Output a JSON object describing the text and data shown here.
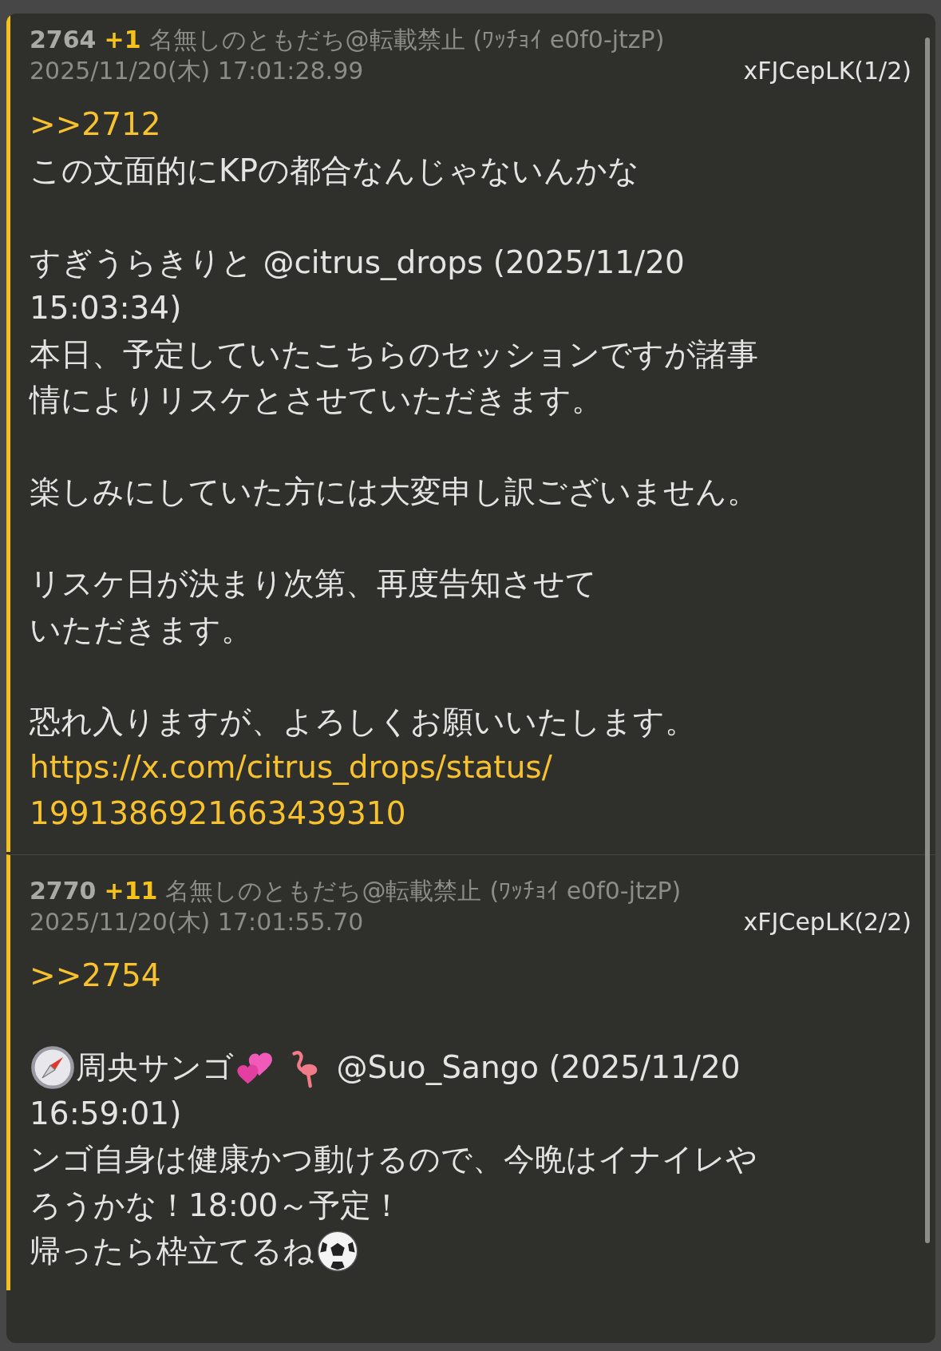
{
  "posts": [
    {
      "number": "2764",
      "votes": "+1",
      "name": "名無しのともだち@転載禁止",
      "trip": "(ﾜｯﾁｮｲ e0f0-jtzP)",
      "date": "2025/11/20(木) 17:01:28.99",
      "id": "xFJCepLK(1/2)",
      "lines": [
        {
          "kind": "quote",
          "text": ">>2712"
        },
        {
          "kind": "text",
          "text": "この文面的にKPの都合なんじゃないんかな"
        },
        {
          "kind": "blank"
        },
        {
          "kind": "text",
          "text": "すぎうらきりと @citrus_drops (2025/11/20"
        },
        {
          "kind": "text",
          "text": "15:03:34)"
        },
        {
          "kind": "text",
          "text": "本日、予定していたこちらのセッションですが諸事"
        },
        {
          "kind": "text",
          "text": "情によりリスケとさせていただきます。"
        },
        {
          "kind": "blank"
        },
        {
          "kind": "text",
          "text": "楽しみにしていた方には大変申し訳ございません。"
        },
        {
          "kind": "blank"
        },
        {
          "kind": "text",
          "text": "リスケ日が決まり次第、再度告知させて"
        },
        {
          "kind": "text",
          "text": "いただきます。"
        },
        {
          "kind": "blank"
        },
        {
          "kind": "text",
          "text": "恐れ入りますが、よろしくお願いいたします。"
        },
        {
          "kind": "link",
          "text": "https://x.com/citrus_drops/status/"
        },
        {
          "kind": "link",
          "text": "1991386921663439310"
        }
      ]
    },
    {
      "number": "2770",
      "votes": "+11",
      "name": "名無しのともだち@転載禁止",
      "trip": "(ﾜｯﾁｮｲ e0f0-jtzP)",
      "date": "2025/11/20(木) 17:01:55.70",
      "id": "xFJCepLK(2/2)",
      "lines": [
        {
          "kind": "quote",
          "text": ">>2754"
        },
        {
          "kind": "blank"
        },
        {
          "kind": "mixed",
          "parts": [
            {
              "kind": "compass"
            },
            {
              "kind": "text",
              "text": "周央サンゴ"
            },
            {
              "kind": "hearts"
            },
            {
              "kind": "flamingo"
            },
            {
              "kind": "text",
              "text": " @Suo_Sango (2025/11/20"
            }
          ]
        },
        {
          "kind": "text",
          "text": "16:59:01)"
        },
        {
          "kind": "text",
          "text": "ンゴ自身は健康かつ動けるので、今晩はイナイレや"
        },
        {
          "kind": "text",
          "text": "ろうかな！18:00～予定！"
        },
        {
          "kind": "mixed",
          "parts": [
            {
              "kind": "text",
              "text": "帰ったら枠立てるね"
            },
            {
              "kind": "ball"
            }
          ]
        }
      ]
    }
  ]
}
